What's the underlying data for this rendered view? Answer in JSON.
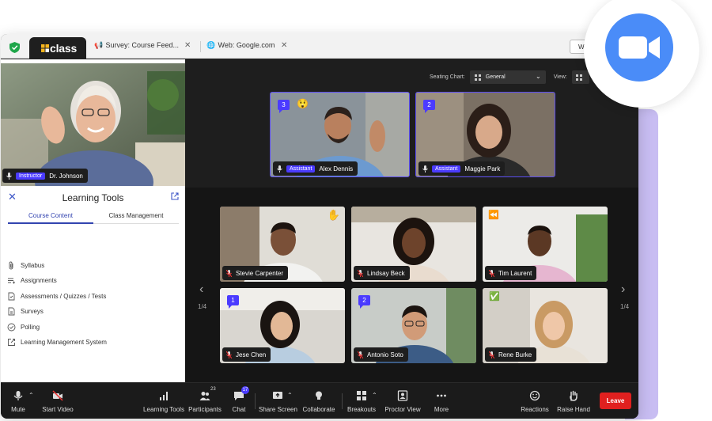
{
  "browser_tabs": {
    "active_logo": "class",
    "tab2": "Survey: Course Feed...",
    "tab3": "Web: Google.com",
    "right_button": "Wh"
  },
  "instructor": {
    "role": "Instructor",
    "name": "Dr. Johnson"
  },
  "learning_tools": {
    "title": "Learning Tools",
    "tabs": [
      "Course Content",
      "Class Management"
    ],
    "items": [
      "Syllabus",
      "Assignments",
      "Assessments / Quizzes / Tests",
      "Surveys",
      "Polling",
      "Learning Management System"
    ]
  },
  "seating": {
    "label": "Seating Chart:",
    "value": "General",
    "view_label": "View:"
  },
  "assistants": [
    {
      "role": "Assistant",
      "name": "Alex Dennis",
      "bubble": "3",
      "reaction": "😲"
    },
    {
      "role": "Assistant",
      "name": "Maggie Park",
      "bubble": "2"
    }
  ],
  "participants": [
    {
      "name": "Stevie Carpenter",
      "reaction": "✋"
    },
    {
      "name": "Lindsay Beck"
    },
    {
      "name": "Tim Laurent",
      "reaction": "⏪"
    },
    {
      "name": "Jese Chen",
      "bubble": "1"
    },
    {
      "name": "Antonio Soto",
      "bubble": "2"
    },
    {
      "name": "Rene Burke",
      "reaction": "✅"
    }
  ],
  "pagination": {
    "left": "1/4",
    "right": "1/4"
  },
  "toolbar": {
    "mute": "Mute",
    "start_video": "Start Video",
    "learning_tools": "Learning Tools",
    "participants": "Participants",
    "participants_count": "23",
    "chat": "Chat",
    "chat_count": "17",
    "share_screen": "Share Screen",
    "collaborate": "Collaborate",
    "breakouts": "Breakouts",
    "proctor_view": "Proctor View",
    "more": "More",
    "reactions": "Reactions",
    "raise_hand": "Raise Hand",
    "leave": "Leave"
  },
  "colors": {
    "accent": "#4b3bff",
    "leave": "#e0201f",
    "zoom": "#4a8cf8",
    "tab_active": "#3344b0"
  },
  "icons": [
    "shield-icon",
    "class-logo-icon",
    "megaphone-icon",
    "globe-icon",
    "close-icon",
    "popout-icon",
    "paperclip-icon",
    "list-icon",
    "document-icon",
    "check-circle-icon",
    "external-link-icon",
    "grid-icon",
    "chevron-down-icon",
    "mic-icon",
    "chevron-left-icon",
    "chevron-right-icon",
    "video-off-icon",
    "signal-icon",
    "people-icon",
    "chat-icon",
    "share-screen-icon",
    "lightbulb-icon",
    "breakout-icon",
    "proctor-icon",
    "more-icon",
    "reactions-icon",
    "hand-icon",
    "zoom-camera-icon"
  ]
}
